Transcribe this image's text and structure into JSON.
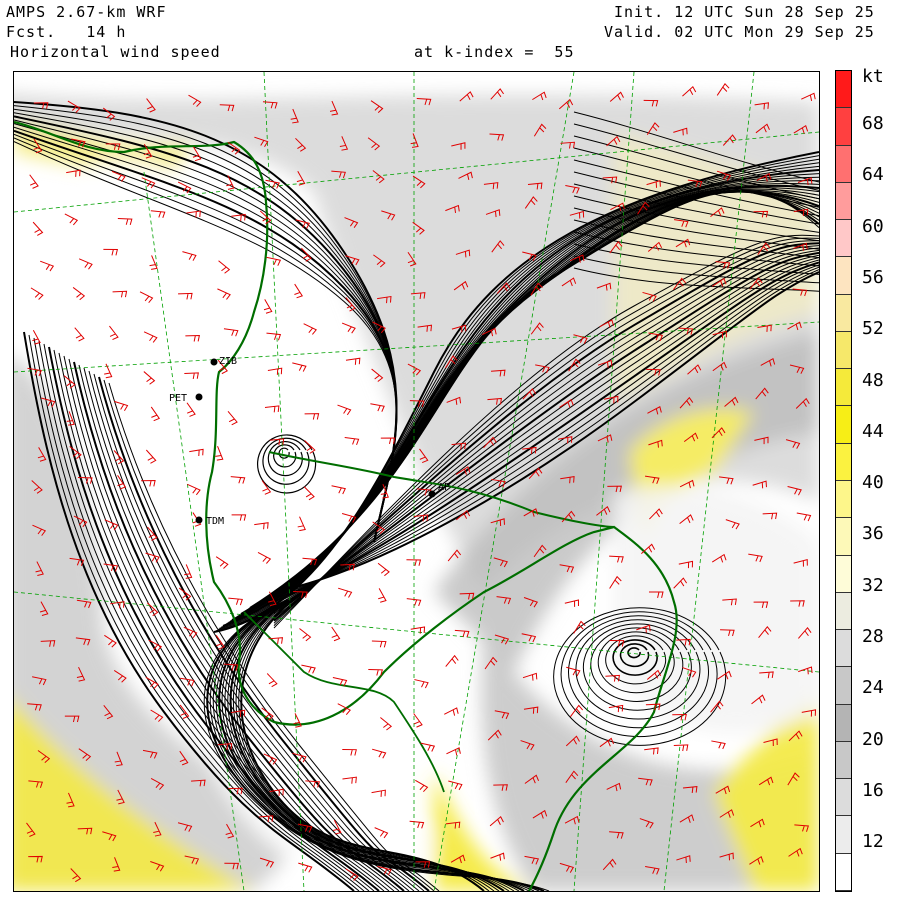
{
  "header": {
    "model": "AMPS 2.67-km WRF",
    "init": "Init. 12 UTC Sun 28 Sep 25",
    "fcst": "Fcst.   14 h",
    "valid": "Valid. 02 UTC Mon 29 Sep 25",
    "field": "Horizontal wind speed",
    "level": "at k-index =  55"
  },
  "colorbar": {
    "unit": "kt",
    "labels": [
      "68",
      "64",
      "60",
      "56",
      "52",
      "48",
      "44",
      "40",
      "36",
      "32",
      "28",
      "24",
      "20",
      "16",
      "12"
    ],
    "colors": [
      "#ff1a1a",
      "#ff4040",
      "#ff7070",
      "#ff9c9c",
      "#ffc8c8",
      "#fde4c0",
      "#f9e9a0",
      "#f6e86a",
      "#f5ea3a",
      "#f7ee16",
      "#fbf240",
      "#fdf68a",
      "#fdf9b8",
      "#fefcd8",
      "#ecece0",
      "#dcdcdc",
      "#c8c8c8",
      "#b4b4b4",
      "#c8c8c8",
      "#dcdcdc",
      "#ececec",
      "#ffffff"
    ]
  },
  "stations": [
    {
      "id": "PET"
    },
    {
      "id": "TDM"
    },
    {
      "id": "ZIB"
    },
    {
      "id": "AP"
    }
  ],
  "colors": {
    "coast": "#006e00",
    "barb": "#e00000",
    "stream": "#000000",
    "grid": "#00a000"
  }
}
